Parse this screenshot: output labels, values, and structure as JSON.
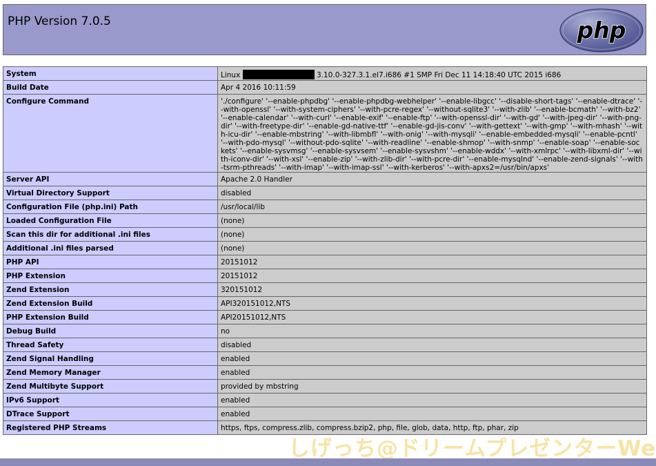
{
  "header": {
    "title": "PHP Version 7.0.5",
    "logo_text": "php"
  },
  "rows": [
    {
      "label": "System",
      "value_prefix": "Linux ",
      "value_suffix": " 3.10.0-327.3.1.el7.i686 #1 SMP Fri Dec 11 14:18:40 UTC 2015 i686"
    },
    {
      "label": "Build Date",
      "value": "Apr 4 2016 10:11:59"
    },
    {
      "label": "Configure Command",
      "value": "'./configure' '--enable-phpdbg' '--enable-phpdbg-webhelper' '--enable-libgcc' '--disable-short-tags' '--enable-dtrace' '--with-openssl' '--with-system-ciphers' '--with-pcre-regex' '--without-sqlite3' '--with-zlib' '--enable-bcmath' '--with-bz2' '--enable-calendar' '--with-curl' '--enable-exif' '--enable-ftp' '--with-openssl-dir' '--with-gd' '--with-jpeg-dir' '--with-png-dir' '--with-freetype-dir' '--enable-gd-native-ttf' '--enable-gd-jis-conv' '--with-gettext' '--with-gmp' '--with-mhash' '--with-icu-dir' '--enable-mbstring' '--with-libmbfl' '--with-onig' '--with-mysqli' '--enable-embedded-mysqli' '--enable-pcntl' '--with-pdo-mysql' '--without-pdo-sqlite' '--with-readline' '--enable-shmop' '--with-snmp' '--enable-soap' '--enable-sockets' '--enable-sysvmsg' '--enable-sysvsem' '--enable-sysvshm' '--enable-wddx' '--with-xmlrpc' '--with-libxml-dir' '--with-iconv-dir' '--with-xsl' '--enable-zip' '--with-zlib-dir' '--with-pcre-dir' '--enable-mysqlnd' '--enable-zend-signals' '--with-tsrm-pthreads' '--with-imap' '--with-imap-ssl' '--with-kerberos' '--with-apxs2=/usr/bin/apxs'"
    },
    {
      "label": "Server API",
      "value": "Apache 2.0 Handler"
    },
    {
      "label": "Virtual Directory Support",
      "value": "disabled"
    },
    {
      "label": "Configuration File (php.ini) Path",
      "value": "/usr/local/lib"
    },
    {
      "label": "Loaded Configuration File",
      "value": "(none)"
    },
    {
      "label": "Scan this dir for additional .ini files",
      "value": "(none)"
    },
    {
      "label": "Additional .ini files parsed",
      "value": "(none)"
    },
    {
      "label": "PHP API",
      "value": "20151012"
    },
    {
      "label": "PHP Extension",
      "value": "20151012"
    },
    {
      "label": "Zend Extension",
      "value": "320151012"
    },
    {
      "label": "Zend Extension Build",
      "value": "API320151012,NTS"
    },
    {
      "label": "PHP Extension Build",
      "value": "API20151012,NTS"
    },
    {
      "label": "Debug Build",
      "value": "no"
    },
    {
      "label": "Thread Safety",
      "value": "disabled"
    },
    {
      "label": "Zend Signal Handling",
      "value": "enabled"
    },
    {
      "label": "Zend Memory Manager",
      "value": "enabled"
    },
    {
      "label": "Zend Multibyte Support",
      "value": "provided by mbstring"
    },
    {
      "label": "IPv6 Support",
      "value": "enabled"
    },
    {
      "label": "DTrace Support",
      "value": "enabled"
    },
    {
      "label": "Registered PHP Streams",
      "value": "https, ftps, compress.zlib, compress.bzip2, php, file, glob, data, http, ftp, phar, zip"
    }
  ],
  "watermark": {
    "text": "しげっち@ドリームプレゼンターWeb"
  },
  "colors": {
    "header_bg": "#9999cc",
    "label_bg": "#ccccff",
    "value_bg": "#cccccc",
    "border": "#666666",
    "logo_bg": "#6181b6"
  }
}
